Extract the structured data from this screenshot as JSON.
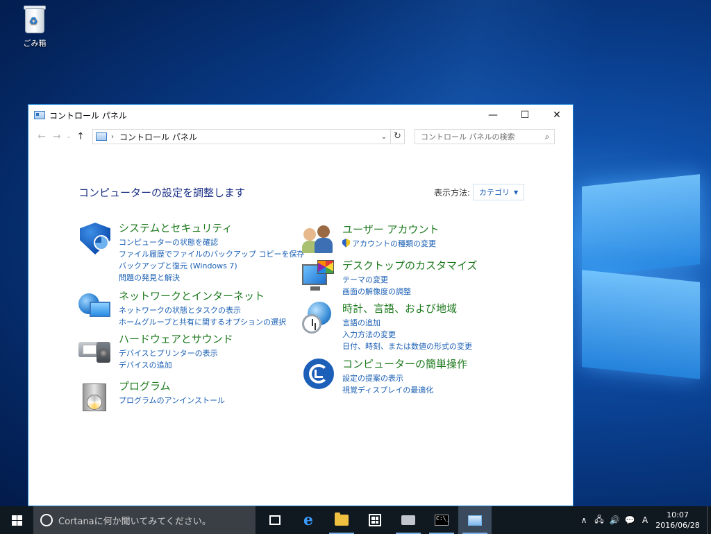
{
  "desktop": {
    "recycle_bin_label": "ごみ箱"
  },
  "window": {
    "title": "コントロール パネル",
    "controls": {
      "minimize": "—",
      "maximize": "☐",
      "close": "✕"
    },
    "nav": {
      "back": "←",
      "forward": "→",
      "recent": "⌄",
      "up": "↑"
    },
    "address": {
      "separator": "›",
      "crumb": "コントロール パネル",
      "dropdown": "⌄",
      "refresh": "↻"
    },
    "search": {
      "placeholder": "コントロール パネルの検索",
      "icon": "⌕"
    }
  },
  "content": {
    "heading": "コンピューターの設定を調整します",
    "view_by_label": "表示方法:",
    "view_by_value": "カテゴリ",
    "categories": [
      {
        "icon": "security-shield-icon",
        "title": "システムとセキュリティ",
        "links": [
          "コンピューターの状態を確認",
          "ファイル履歴でファイルのバックアップ コピーを保存",
          "バックアップと復元 (Windows 7)",
          "問題の発見と解決"
        ]
      },
      {
        "icon": "network-globe-icon",
        "title": "ネットワークとインターネット",
        "links": [
          "ネットワークの状態とタスクの表示",
          "ホームグループと共有に関するオプションの選択"
        ]
      },
      {
        "icon": "printer-speaker-icon",
        "title": "ハードウェアとサウンド",
        "links": [
          "デバイスとプリンターの表示",
          "デバイスの追加"
        ]
      },
      {
        "icon": "programs-box-icon",
        "title": "プログラム",
        "links": [
          "プログラムのアンインストール"
        ]
      },
      {
        "icon": "user-accounts-icon",
        "title": "ユーザー アカウント",
        "links": [
          "アカウントの種類の変更"
        ]
      },
      {
        "icon": "desktop-monitor-icon",
        "title": "デスクトップのカスタマイズ",
        "links": [
          "テーマの変更",
          "画面の解像度の調整"
        ]
      },
      {
        "icon": "clock-globe-icon",
        "title": "時計、言語、および地域",
        "links": [
          "言語の追加",
          "入力方法の変更",
          "日付、時刻、または数値の形式の変更"
        ]
      },
      {
        "icon": "ease-of-access-icon",
        "title": "コンピューターの簡単操作",
        "links": [
          "設定の提案の表示",
          "視覚ディスプレイの最適化"
        ]
      }
    ]
  },
  "taskbar": {
    "cortana_placeholder": "Cortanaに何か聞いてみてください。",
    "tray": {
      "chevron": "∧",
      "network": "🖧",
      "volume": "🔊",
      "notifications": "💬",
      "ime": "A",
      "time": "10:07",
      "date": "2016/06/28"
    }
  }
}
